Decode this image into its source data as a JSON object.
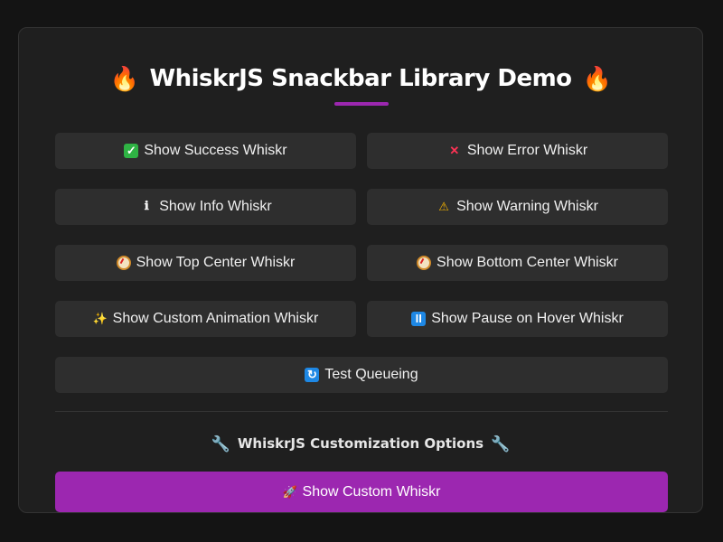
{
  "header": {
    "title": "WhiskrJS Snackbar Library Demo",
    "accent_color": "#9c27b0"
  },
  "buttons": {
    "success": {
      "icon": "check-mark-icon",
      "label": "Show Success Whiskr"
    },
    "error": {
      "icon": "cross-mark-icon",
      "label": "Show Error Whiskr"
    },
    "info": {
      "icon": "info-icon",
      "label": "Show Info Whiskr"
    },
    "warning": {
      "icon": "warning-icon",
      "label": "Show Warning Whiskr"
    },
    "top_center": {
      "icon": "compass-icon",
      "label": "Show Top Center Whiskr"
    },
    "bottom_center": {
      "icon": "compass-icon",
      "label": "Show Bottom Center Whiskr"
    },
    "custom_animation": {
      "icon": "sparkles-icon",
      "label": "Show Custom Animation Whiskr"
    },
    "pause_on_hover": {
      "icon": "pause-icon",
      "label": "Show Pause on Hover Whiskr"
    },
    "queueing": {
      "icon": "queue-icon",
      "label": "Test Queueing"
    }
  },
  "customization": {
    "title": "WhiskrJS Customization Options",
    "custom_button": {
      "icon": "rocket-icon",
      "label": "Show Custom Whiskr"
    }
  },
  "colors": {
    "background": "#141414",
    "card": "#1f1f1f",
    "button": "#2e2e2e",
    "primary": "#9c27b0"
  }
}
